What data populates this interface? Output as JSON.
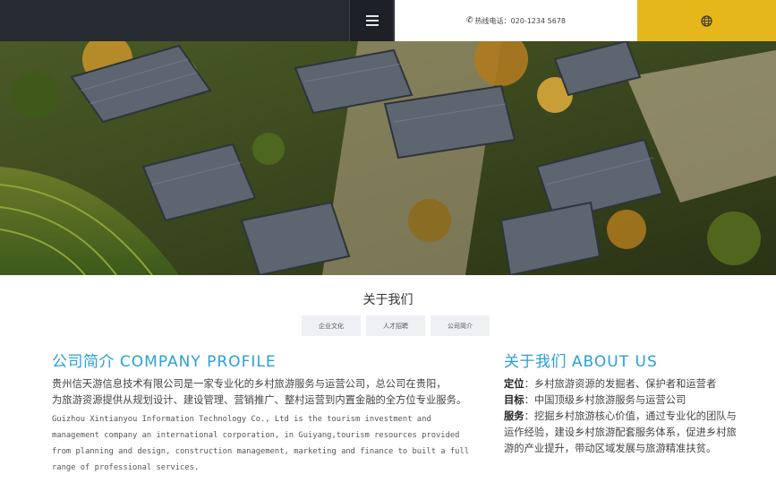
{
  "header": {
    "hotline_label": "热线电话：",
    "hotline_number": "020-1234 5678",
    "accent_color": "#e6b71a",
    "bar_color": "#262a31"
  },
  "banner": {
    "description_icon": "village-aerial-photo"
  },
  "section": {
    "title": "关于我们",
    "tabs": [
      {
        "label": "企业文化"
      },
      {
        "label": "人才招聘"
      },
      {
        "label": "公司简介"
      }
    ]
  },
  "profile": {
    "heading_cn": "公司简介",
    "heading_en": "COMPANY PROFILE",
    "text_cn_1": "贵州信天游信息技术有限公司是一家专业化的乡村旅游服务与运营公司，总公司在贵阳，",
    "text_cn_2": "为旅游资源提供从规划设计、建设管理、营销推广、整村运营到内置金融的全方位专业服务。",
    "text_en": "Guizhou Xintianyou Information Technology Co., Ltd is the tourism investment and management company an international corporation, in Guiyang,tourism resources provided from planning and design, construction management, marketing and finance to built a full range of professional services."
  },
  "about": {
    "heading_cn": "关于我们",
    "heading_en": "ABOUT US",
    "rows": [
      {
        "label": "定位",
        "text": "：乡村旅游资源的发掘者、保护者和运营者"
      },
      {
        "label": "目标",
        "text": "：中国顶级乡村旅游服务与运营公司"
      },
      {
        "label": "服务",
        "text": "：挖掘乡村旅游核心价值，通过专业化的团队与运作经验，建设乡村旅游配套服务体系，促进乡村旅游的产业提升，带动区域发展与旅游精准扶贫。"
      }
    ],
    "heading_color": "#2aa0d8"
  }
}
